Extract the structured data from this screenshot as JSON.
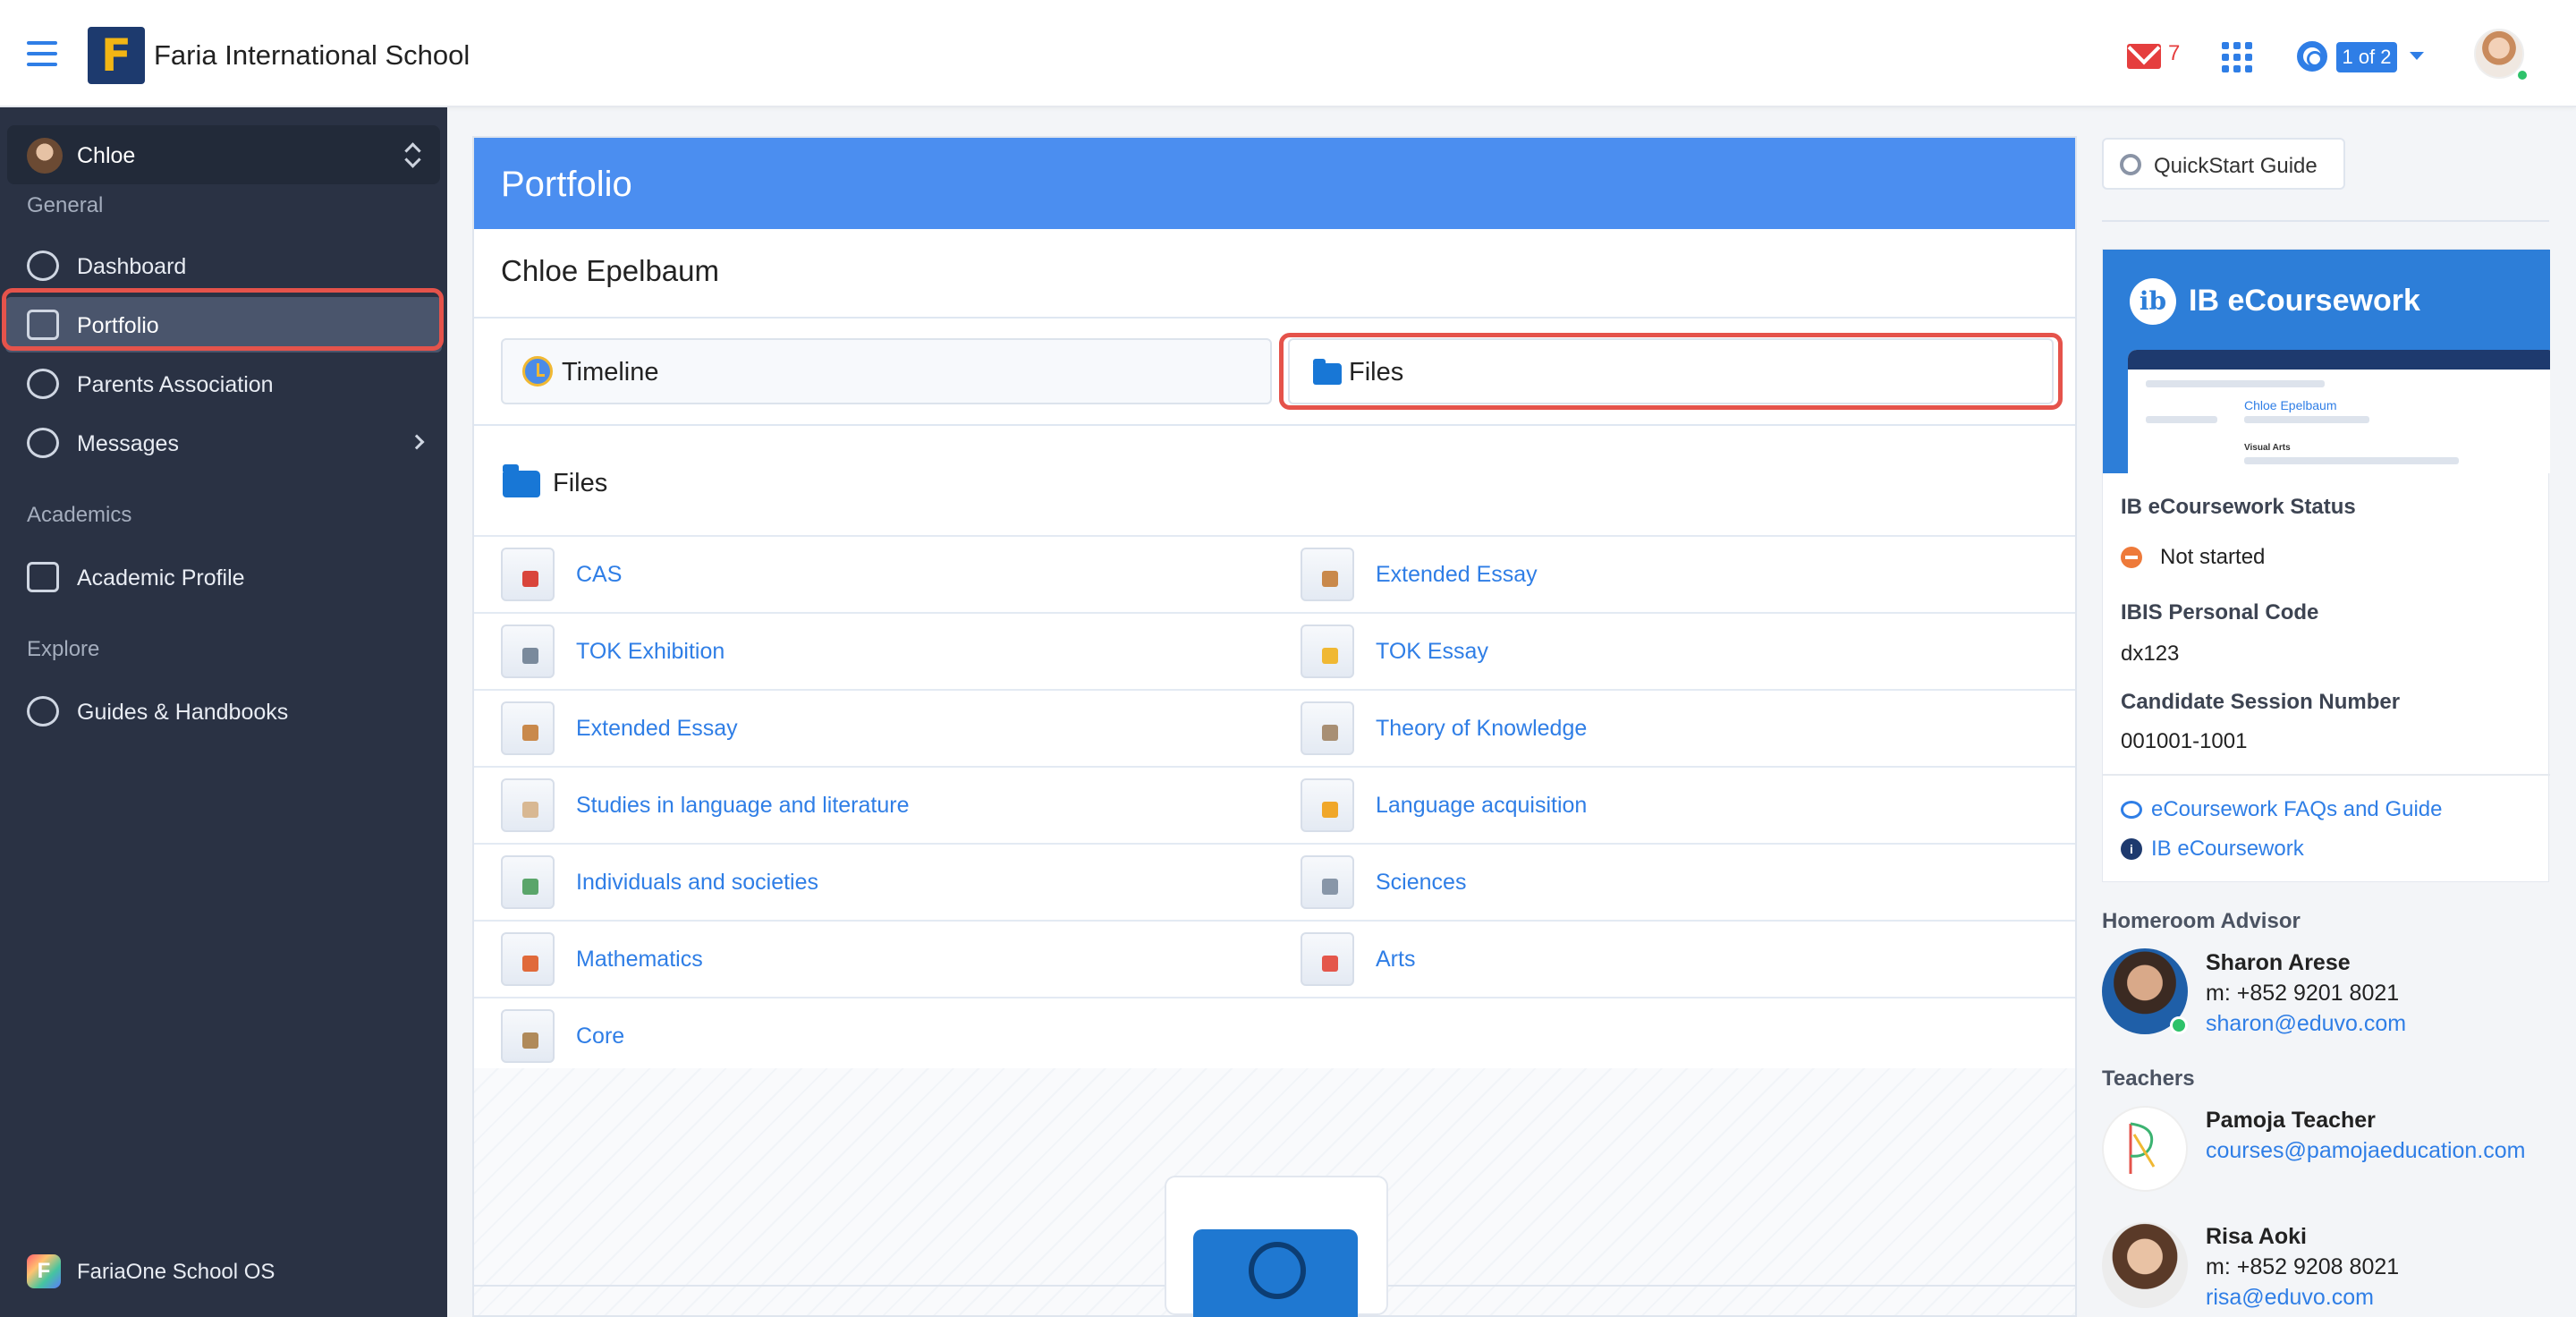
{
  "header": {
    "school_name": "Faria International School",
    "mail_count": "7",
    "switch_badge": "1 of 2"
  },
  "sidebar": {
    "user_name": "Chloe",
    "sections": {
      "general": "General",
      "academics": "Academics",
      "explore": "Explore"
    },
    "items": [
      {
        "label": "Dashboard",
        "icon": "dashboard-icon"
      },
      {
        "label": "Portfolio",
        "icon": "briefcase-icon",
        "active": true
      },
      {
        "label": "Parents Association",
        "icon": "people-icon"
      },
      {
        "label": "Messages",
        "icon": "chat-icon"
      },
      {
        "label": "Academic Profile",
        "icon": "document-icon"
      },
      {
        "label": "Guides & Handbooks",
        "icon": "guides-icon"
      }
    ],
    "footer_label": "FariaOne School OS"
  },
  "main": {
    "title": "Portfolio",
    "student_name": "Chloe Epelbaum",
    "tabs": [
      {
        "label": "Timeline",
        "icon": "clock-icon"
      },
      {
        "label": "Files",
        "icon": "folder-icon",
        "selected": true
      }
    ],
    "files_heading": "Files",
    "files_left": [
      "CAS",
      "TOK Exhibition",
      "Extended Essay",
      "Studies in language and literature",
      "Individuals and societies",
      "Mathematics",
      "Core"
    ],
    "files_right": [
      "Extended Essay",
      "TOK Essay",
      "Theory of Knowledge",
      "Language acquisition",
      "Sciences",
      "Arts"
    ]
  },
  "right": {
    "quickstart_label": "QuickStart Guide",
    "ib": {
      "banner_title": "IB eCoursework",
      "screenshot_name": "Chloe Epelbaum",
      "screenshot_subject": "Visual Arts",
      "status_label": "IB eCoursework Status",
      "status_value": "Not started",
      "code_label": "IBIS Personal Code",
      "code_value": "dx123",
      "session_label": "Candidate Session Number",
      "session_value": "001001-1001",
      "link_faq": "eCoursework FAQs and Guide",
      "link_ib": "IB eCoursework"
    },
    "homeroom_heading": "Homeroom Advisor",
    "homeroom": {
      "name": "Sharon Arese",
      "phone": "m: +852 9201 8021",
      "email": "sharon@eduvo.com"
    },
    "teachers_heading": "Teachers",
    "teachers": [
      {
        "name": "Pamoja Teacher",
        "email": "courses@pamojaeducation.com"
      },
      {
        "name": "Risa Aoki",
        "phone": "m: +852 9208 8021",
        "email": "risa@eduvo.com"
      }
    ]
  },
  "colors": {
    "accent": "#2f7ee6",
    "header_blue": "#4b8ef0",
    "sidebar_bg": "#2a3244",
    "highlight_red": "#e5534b",
    "mail_red": "#e53e3e",
    "status_orange": "#ee7a3a"
  }
}
